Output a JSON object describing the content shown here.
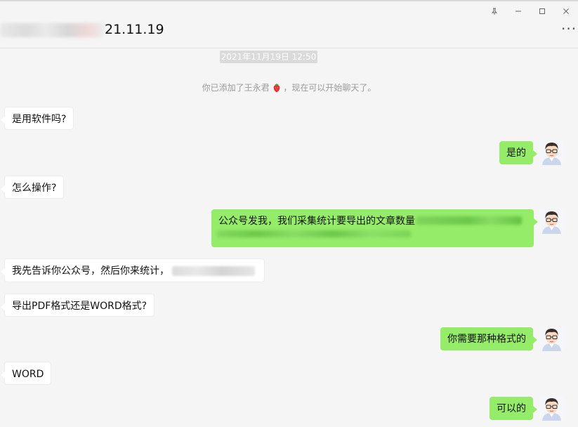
{
  "window": {
    "title_suffix": "21.11.19",
    "controls": {
      "pin": "⊥",
      "minimize": "—",
      "maximize": "□",
      "close": "✕"
    },
    "more": "···"
  },
  "chat": {
    "timestamp": "2021年11月19日 12:50",
    "system_message": "你已添加了王永君",
    "system_message_tail": "，现在可以开始聊天了。",
    "messages": [
      {
        "side": "in",
        "text": "是用软件吗?"
      },
      {
        "side": "out",
        "text": "是的"
      },
      {
        "side": "in",
        "text": "怎么操作?"
      },
      {
        "side": "out",
        "text": "公众号发我，我们采集统计要导出的文章数量"
      },
      {
        "side": "in",
        "text": "我先告诉你公众号，然后你来统计，"
      },
      {
        "side": "in",
        "text": "导出PDF格式还是WORD格式?"
      },
      {
        "side": "out",
        "text": "你需要那种格式的"
      },
      {
        "side": "in",
        "text": "WORD"
      },
      {
        "side": "out",
        "text": "可以的"
      }
    ]
  },
  "colors": {
    "outgoing_bubble": "#95ec69",
    "incoming_bubble": "#ffffff",
    "background": "#f5f5f5",
    "timestamp_bg": "#dadada"
  }
}
